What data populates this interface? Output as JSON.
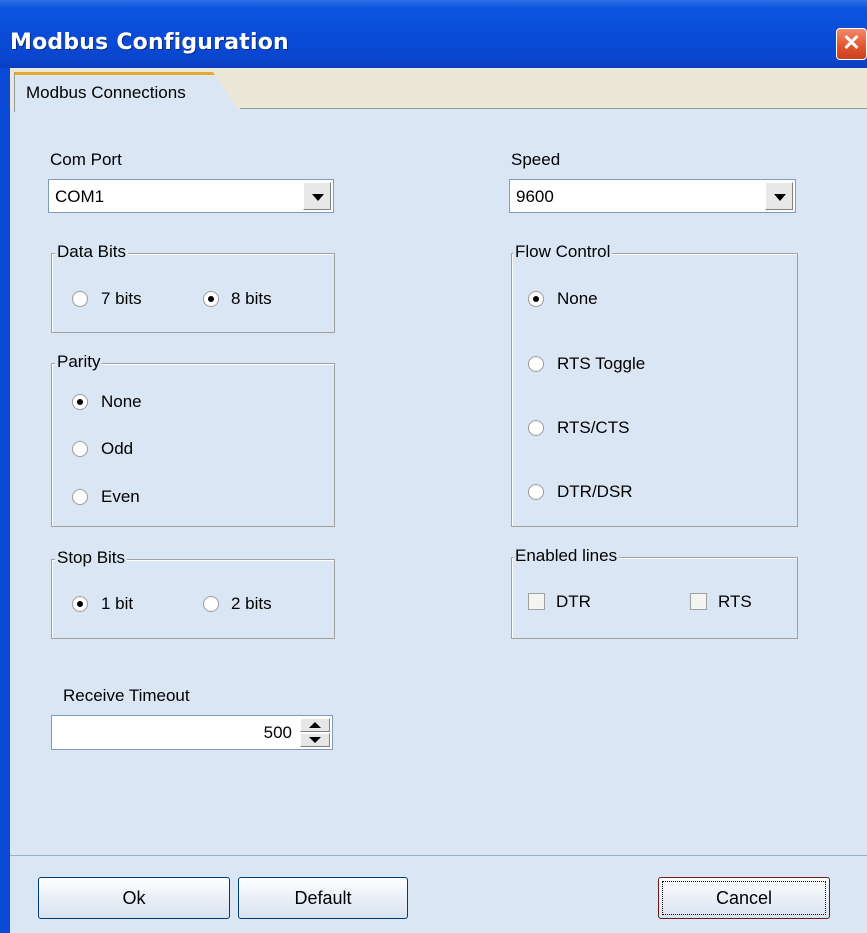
{
  "window": {
    "title": "Modbus Configuration",
    "close_glyph": "✕"
  },
  "tabs": [
    {
      "label": "Modbus Connections",
      "active": true
    }
  ],
  "com_port": {
    "label": "Com Port",
    "value": "COM1"
  },
  "speed": {
    "label": "Speed",
    "value": "9600"
  },
  "data_bits": {
    "legend": "Data Bits",
    "options": [
      "7 bits",
      "8 bits"
    ],
    "selected": "8 bits"
  },
  "parity": {
    "legend": "Parity",
    "options": [
      "None",
      "Odd",
      "Even"
    ],
    "selected": "None"
  },
  "stop_bits": {
    "legend": "Stop Bits",
    "options": [
      "1 bit",
      "2 bits"
    ],
    "selected": "1 bit"
  },
  "flow_control": {
    "legend": "Flow Control",
    "options": [
      "None",
      "RTS Toggle",
      "RTS/CTS",
      "DTR/DSR"
    ],
    "selected": "None"
  },
  "enabled_lines": {
    "legend": "Enabled lines",
    "options": [
      "DTR",
      "RTS"
    ],
    "checked": []
  },
  "receive_timeout": {
    "label": "Receive Timeout",
    "value": "500"
  },
  "buttons": {
    "ok": "Ok",
    "default": "Default",
    "cancel": "Cancel"
  },
  "colors": {
    "titlebar": "#0a4cd8",
    "panel": "#dbe6f4",
    "close": "#e2532d"
  }
}
